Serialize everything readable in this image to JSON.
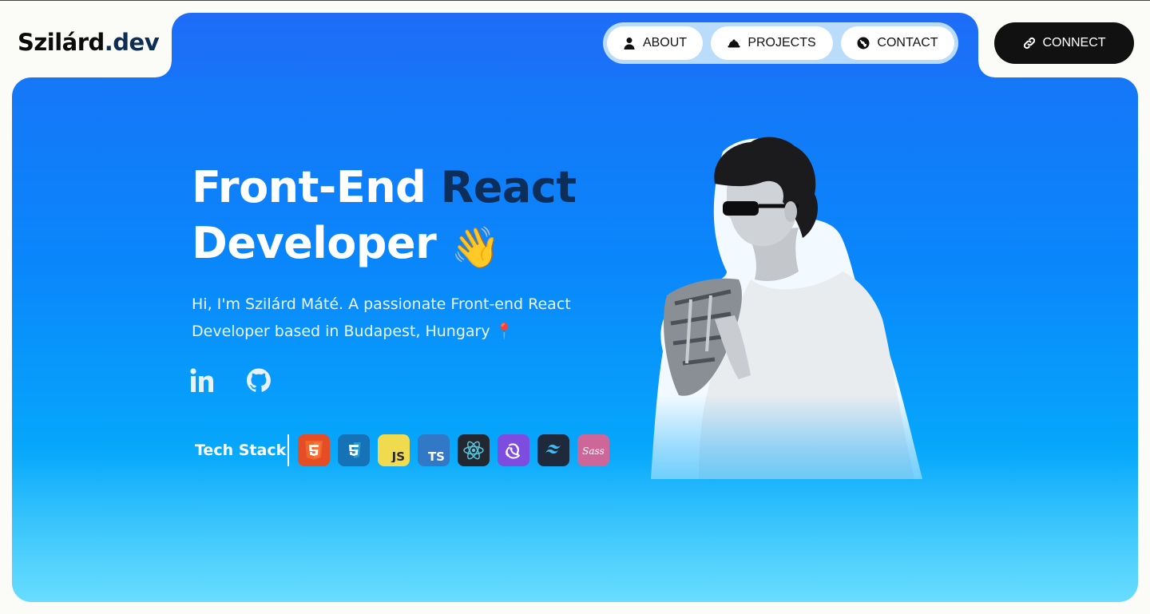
{
  "logo": {
    "name": "Szilárd",
    "tld": ".dev"
  },
  "nav": [
    {
      "label": "ABOUT",
      "icon": "user-icon"
    },
    {
      "label": "PROJECTS",
      "icon": "hard-hat-icon"
    },
    {
      "label": "CONTACT",
      "icon": "globe-icon"
    }
  ],
  "connect": {
    "label": "CONNECT",
    "icon": "link-icon"
  },
  "hero": {
    "title_part1": "Front-End ",
    "title_accent": "React",
    "title_part2": "Developer",
    "wave_emoji": "👋",
    "intro": "Hi, I'm Szilárd Máté. A passionate Front-end React Developer based in Budapest, Hungary 📍",
    "socials": [
      {
        "name": "linkedin-icon"
      },
      {
        "name": "github-icon"
      }
    ]
  },
  "tech_stack": {
    "label": "Tech Stack",
    "items": [
      {
        "name": "html5-icon",
        "color": "#e44d26"
      },
      {
        "name": "css3-icon",
        "color": "#1572b6"
      },
      {
        "name": "javascript-icon",
        "color": "#f0db4f"
      },
      {
        "name": "typescript-icon",
        "color": "#3178c6"
      },
      {
        "name": "react-icon",
        "color": "#23272f"
      },
      {
        "name": "redux-icon",
        "color": "#7f4ce0"
      },
      {
        "name": "tailwind-icon",
        "color": "#1e293b"
      },
      {
        "name": "sass-icon",
        "color": "#cd6799"
      }
    ]
  },
  "colors": {
    "accent_dark": "#0b2e5a",
    "hero_blue": "#0a86fb",
    "connect_bg": "#111111"
  }
}
